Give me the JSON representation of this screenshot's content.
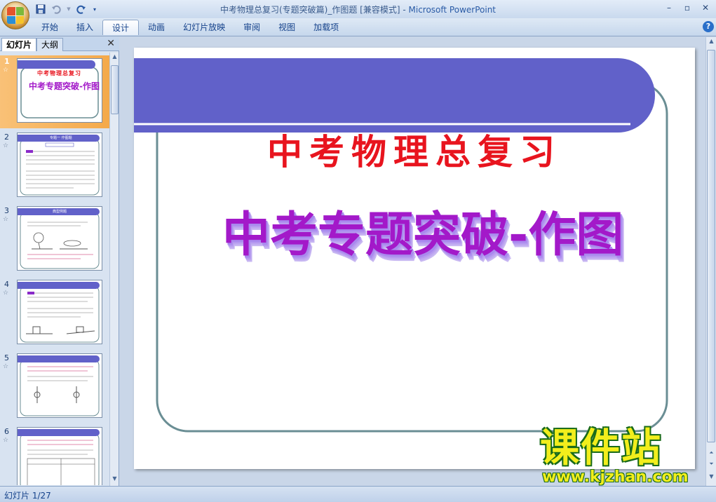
{
  "window": {
    "title": "中考物理总复习(专题突破篇)_作图题 [兼容模式] - ",
    "app_name": "Microsoft PowerPoint",
    "minimize": "–",
    "restore": "▫",
    "close": "✕"
  },
  "ribbon": {
    "tabs": [
      "开始",
      "插入",
      "设计",
      "动画",
      "幻灯片放映",
      "审阅",
      "视图",
      "加载项"
    ],
    "active_tab": "设计",
    "help": "?"
  },
  "left_pane": {
    "tab_slides": "幻灯片",
    "tab_outline": "大纲",
    "close": "✕",
    "thumbnails": [
      {
        "num": "1",
        "subtitle": "中考物理总复习",
        "title": "中考专题突破-作图"
      },
      {
        "num": "2",
        "header": "专题一  作图题"
      },
      {
        "num": "3",
        "header": "典型例题"
      },
      {
        "num": "4",
        "header": ""
      },
      {
        "num": "5",
        "header": ""
      },
      {
        "num": "6",
        "header": ""
      }
    ],
    "star": "☆"
  },
  "slide": {
    "subtitle": "中考物理总复习",
    "title": "中考专题突破-作图"
  },
  "status": {
    "text": "幻灯片 1/27"
  },
  "watermark": {
    "brand": "课件站",
    "url": "www.kjzhan.com"
  },
  "colors": {
    "banner": "#6161c9",
    "frame": "#6a8e94",
    "subtitle": "#e8141e",
    "title_top": "#a319c9",
    "title_shadow": "#b8a6f0"
  }
}
